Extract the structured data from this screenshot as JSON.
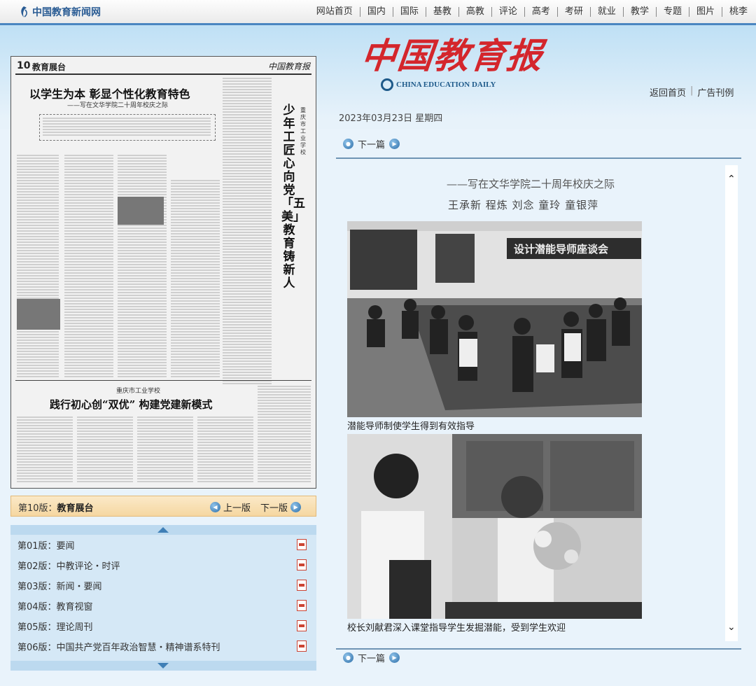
{
  "site": {
    "logo_text": "中国教育新闻网",
    "nav": [
      "网站首页",
      "国内",
      "国际",
      "基教",
      "高教",
      "评论",
      "高考",
      "考研",
      "就业",
      "教学",
      "专题",
      "图片",
      "桃李"
    ]
  },
  "header": {
    "masthead_cn": "中国教育报",
    "masthead_en": "CHINA EDUCATION DAILY",
    "links": [
      "返回首页",
      "广告刊例"
    ]
  },
  "paper_page": {
    "page_no": "10",
    "section": "教育展台",
    "top_title": "以学生为本 彰显个性化教育特色",
    "top_subtitle": "——写在文华学院二十周年校庆之际",
    "vertical_headline": "少年工匠心向党「五美」教育铸新人",
    "vertical_school": "重庆市工业学校",
    "bottom_school": "重庆市工业学校",
    "bottom_title": "践行初心创“双优” 构建党建新模式"
  },
  "edition_bar": {
    "current_label": "第10版：",
    "current_name": "教育展台",
    "prev": "上一版",
    "next": "下一版"
  },
  "editions": [
    "第01版：要闻",
    "第02版：中教评论・时评",
    "第03版：新闻・要闻",
    "第04版：教育视窗",
    "第05版：理论周刊",
    "第06版：中国共产党百年政治智慧・精神谱系特刊"
  ],
  "reader": {
    "date": "2023年03月23日  星期四",
    "next_top": "下一篇",
    "next_bottom": "下一篇",
    "subtitle": "——写在文华学院二十周年校庆之际",
    "authors": "王承新  程炼  刘念  童玲  童银萍",
    "photo1_banner": "设计潜能导师座谈会",
    "caption1": "潜能导师制使学生得到有效指导",
    "caption2": "校长刘献君深入课堂指导学生发掘潜能，受到学生欢迎"
  }
}
